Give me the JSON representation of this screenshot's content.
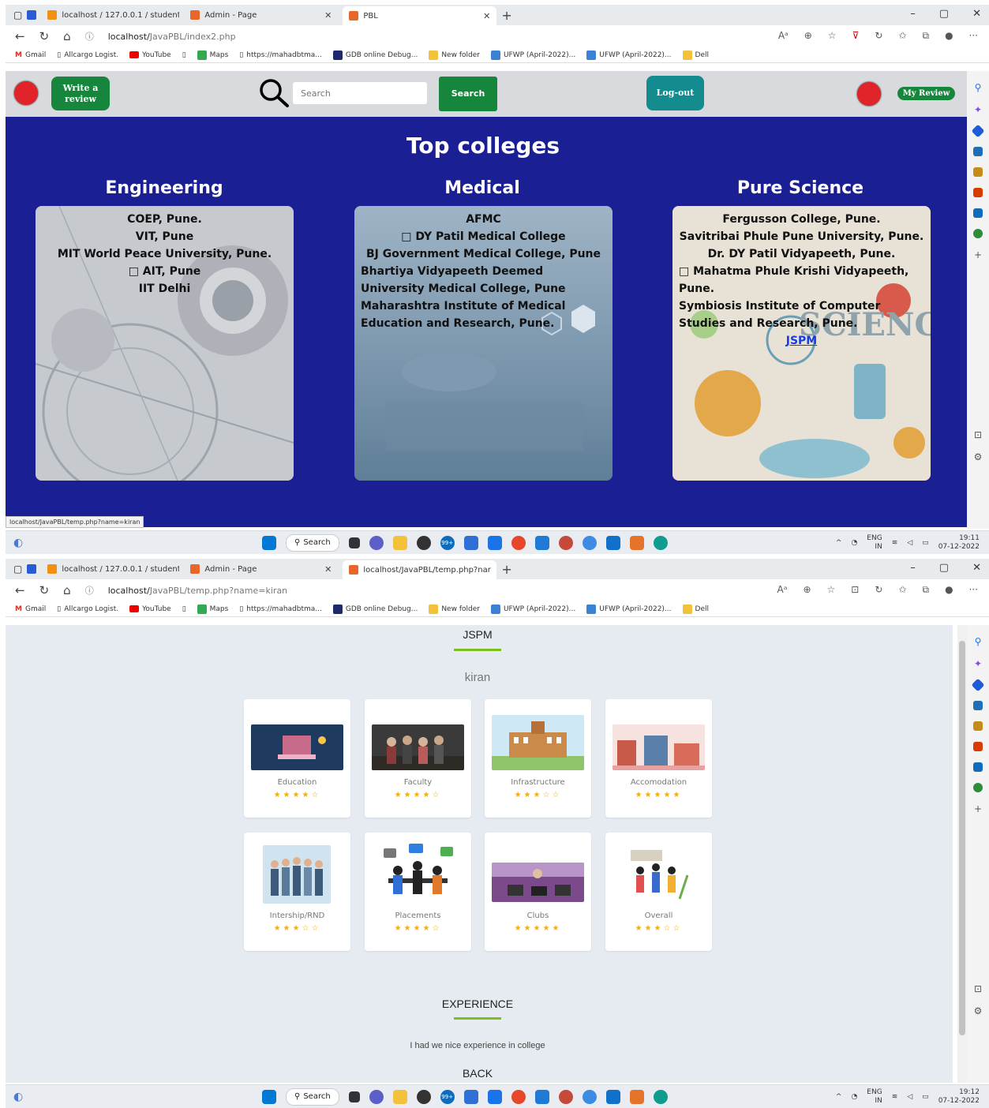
{
  "browser": {
    "tabs1": [
      {
        "label": "localhost / 127.0.0.1 / student / "
      },
      {
        "label": "Admin - Page"
      },
      {
        "label": "PBL"
      }
    ],
    "tabs2": [
      {
        "label": "localhost / 127.0.0.1 / student / "
      },
      {
        "label": "Admin - Page"
      },
      {
        "label": "localhost/JavaPBL/temp.php?nar"
      }
    ],
    "url1": "localhost/JavaPBL/index2.php",
    "url2": "localhost/JavaPBL/temp.php?name=kiran",
    "url2_host": "localhost/",
    "url2_path": "JavaPBL/temp.php?name=kiran",
    "url1_host": "localhost/",
    "url1_path": "JavaPBL/index2.php",
    "bookmarks": [
      "Gmail",
      "Allcargo Logist.",
      "YouTube",
      "",
      "Maps",
      "https://mahadbtma...",
      "GDB online Debug...",
      "New folder",
      "UFWP (April-2022)...",
      "UFWP (April-2022)...",
      "Dell"
    ],
    "status_url": "localhost/JavaPBL/temp.php?name=kiran",
    "taskbar_search": "Search",
    "tray_lang1": "ENG",
    "tray_lang2": "IN",
    "time1": "19:11",
    "date1": "07-12-2022",
    "time2": "19:12",
    "date2": "07-12-2022",
    "badge": "99+"
  },
  "page1": {
    "write_review": "Write a review",
    "search_placeholder": "Search",
    "search_button": "Search",
    "logout": "Log-out",
    "my_review": "My Review",
    "title": "Top colleges",
    "columns": [
      {
        "title": "Engineering",
        "items": [
          "COEP, Pune.",
          "VIT, Pune",
          "MIT World Peace University, Pune.",
          "□ AIT, Pune",
          "IIT Delhi"
        ]
      },
      {
        "title": "Medical",
        "items": [
          "AFMC",
          "□ DY Patil Medical College",
          "BJ Government Medical College, Pune",
          "Bhartiya Vidyapeeth Deemed University Medical College, Pune",
          "Maharashtra Institute of Medical Education and Research, Pune."
        ]
      },
      {
        "title": "Pure Science",
        "items": [
          "Fergusson College, Pune.",
          "Savitribai Phule Pune University, Pune.",
          "Dr. DY Patil Vidyapeeth, Pune.",
          "□ Mahatma Phule Krishi Vidyapeeth, Pune.",
          "Symbiosis Institute of Computer Studies and Research, Pune."
        ],
        "link": "JSPM",
        "bg_word": "SCIENCE"
      }
    ]
  },
  "page2": {
    "college": "JSPM",
    "user": "kiran",
    "ratings": [
      {
        "label": "Education",
        "stars": 4
      },
      {
        "label": "Faculty",
        "stars": 4
      },
      {
        "label": "Infrastructure",
        "stars": 3
      },
      {
        "label": "Accomodation",
        "stars": 5
      },
      {
        "label": "Intership/RND",
        "stars": 3
      },
      {
        "label": "Placements",
        "stars": 4
      },
      {
        "label": "Clubs",
        "stars": 5
      },
      {
        "label": "Overall",
        "stars": 3
      }
    ],
    "experience_heading": "EXPERIENCE",
    "experience_text": "I had we nice experience in college",
    "back": "BACK"
  },
  "colors": {
    "blue_bg": "#1a1f94",
    "green": "#16863d",
    "teal": "#138c8f",
    "red": "#e0242a",
    "accent_line": "#7cc020"
  }
}
